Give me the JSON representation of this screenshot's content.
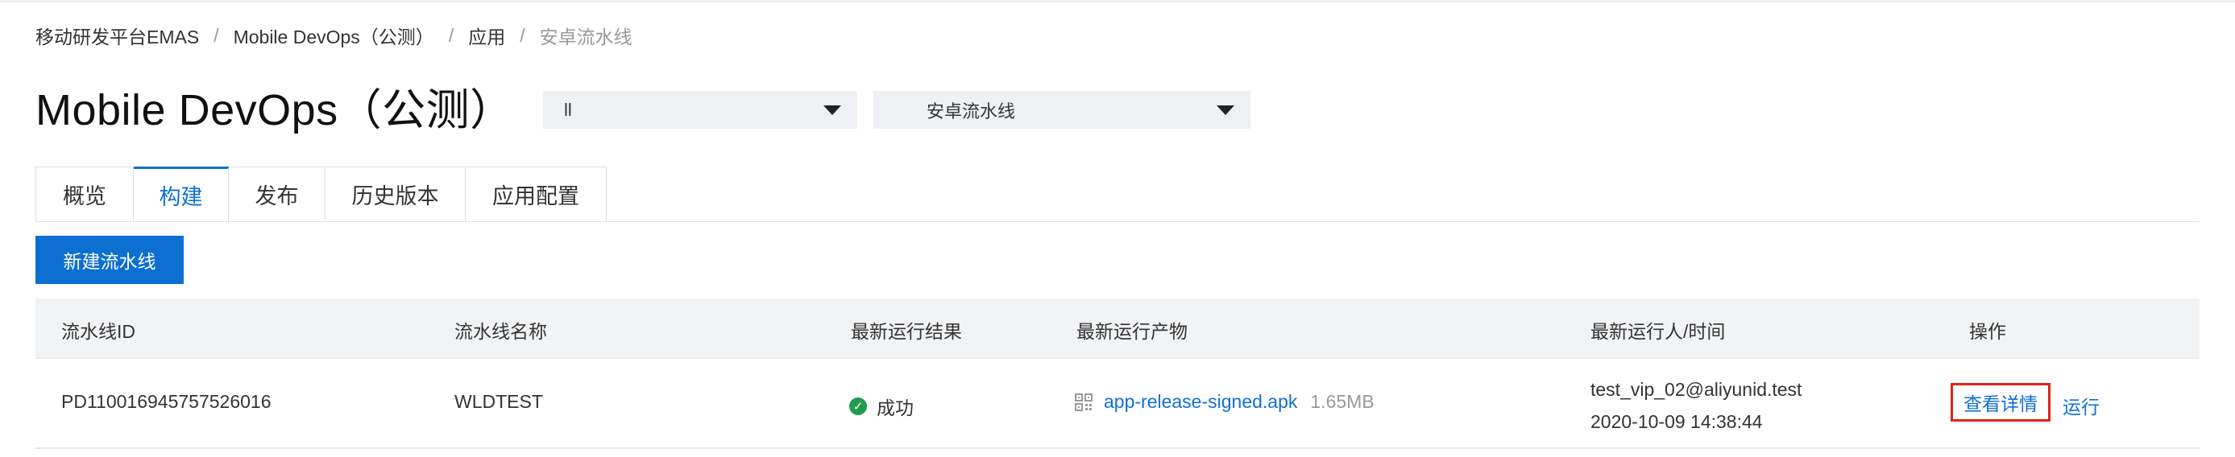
{
  "breadcrumb": {
    "items": [
      "移动研发平台EMAS",
      "Mobile DevOps（公测）",
      "应用"
    ],
    "current": "安卓流水线",
    "separator": "/"
  },
  "page": {
    "title": "Mobile DevOps（公测）"
  },
  "selects": {
    "app_value": "ll",
    "pipeline_value": "安卓流水线"
  },
  "tabs": [
    {
      "label": "概览",
      "active": false
    },
    {
      "label": "构建",
      "active": true
    },
    {
      "label": "发布",
      "active": false
    },
    {
      "label": "历史版本",
      "active": false
    },
    {
      "label": "应用配置",
      "active": false
    }
  ],
  "actions": {
    "new_pipeline_label": "新建流水线"
  },
  "table": {
    "columns": [
      "流水线ID",
      "流水线名称",
      "最新运行结果",
      "最新运行产物",
      "最新运行人/时间",
      "操作"
    ],
    "rows": [
      {
        "id": "PD110016945757526016",
        "name": "WLDTEST",
        "result": "成功",
        "artifact_name": "app-release-signed.apk",
        "artifact_size": "1.65MB",
        "runner": "test_vip_02@aliyunid.test",
        "time": "2020-10-09 14:38:44",
        "action_detail": "查看详情",
        "action_run": "运行"
      }
    ]
  },
  "colors": {
    "accent": "#0f6fd6",
    "primary_button": "#0d6fd2",
    "success": "#1f9d4c",
    "highlight_border": "#e0231a"
  },
  "icons": {
    "status": "check-circle-icon",
    "artifact": "qr-code-icon",
    "dropdown": "caret-down-icon"
  }
}
